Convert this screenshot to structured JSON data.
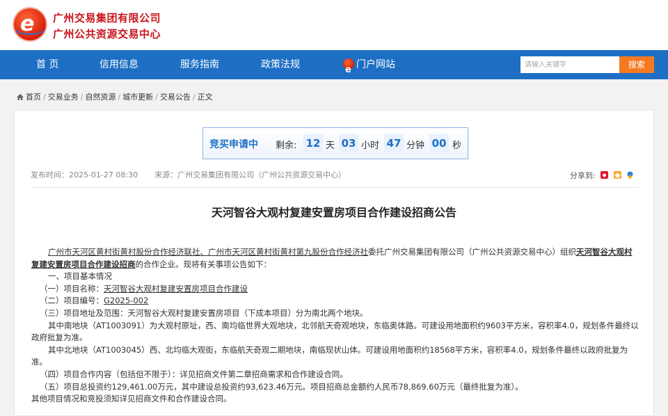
{
  "header": {
    "org_name_1": "广州交易集团有限公司",
    "org_name_2": "广州公共资源交易中心"
  },
  "nav": {
    "items": [
      "首 页",
      "信用信息",
      "服务指南",
      "政策法规",
      "门户网站"
    ],
    "search_placeholder": "请输入关键字",
    "search_button": "搜索",
    "bg_color": "#1e6fc4",
    "accent_color": "#f47920"
  },
  "breadcrumb": [
    "首页",
    "交易业务",
    "自然资源",
    "城市更新",
    "交易公告",
    "正文"
  ],
  "countdown": {
    "status": "竞买申请中",
    "remain_label": "剩余:",
    "days": "12",
    "days_unit": "天",
    "hours": "03",
    "hours_unit": "小时",
    "minutes": "47",
    "minutes_unit": "分钟",
    "seconds": "00",
    "seconds_unit": "秒"
  },
  "article": {
    "publish_time": "发布时间：2025-01-27 08:30",
    "source": "来源：广州交易集团有限公司（广州公共资源交易中心）",
    "share_label": "分享到:",
    "title": "天河智谷大观村复建安置房项目合作建设招商公告",
    "p1_a": "广州市天河区黄村街黄村股份合作经济联社、广州市天河区黄村街黄村第九股份合作经济社",
    "p1_b": "委托广州交易集团有限公司（广州公共资源交易中心）组织",
    "p1_c": "天河智谷大观村复建安置房项目合作建设招商",
    "p1_d": "的合作企业。现将有关事项公告如下：",
    "s1": "一、项目基本情况",
    "s1_1_label": "（一）项目名称：",
    "s1_1_value": "天河智谷大观村复建安置房项目合作建设",
    "s1_2_label": "（二）项目编号：",
    "s1_2_value": "G2025-002",
    "s1_3": "（三）项目地址及范围：天河智谷大观村复建安置房项目（下成本项目）分为南北两个地块。",
    "south": "其中南地块（AT1003091）为大观村原址，西、南均临世界大观地块，北邻航天奇观地块，东临奥体路。可建设用地面积约9603平方米，容积率4.0，规划条件最终以政府批复为准。",
    "north": "其中北地块（AT1003045）西、北均临大观街，东临航天奇观二期地块，南临现状山体。可建设用地面积约18568平方米，容积率4.0，规划条件最终以政府批复为准。",
    "s1_4": "（四）项目合作内容（包括但不限于）：详见招商文件第二章招商需求和合作建设合同。",
    "s1_5": "（五）项目总投资约129,461.00万元，其中建设总投资约93,623.46万元。项目招商总金额约人民币78,869.60万元（最终批复为准）。",
    "other": "其他项目情况和竞投须知详见招商文件和合作建设合同。"
  }
}
